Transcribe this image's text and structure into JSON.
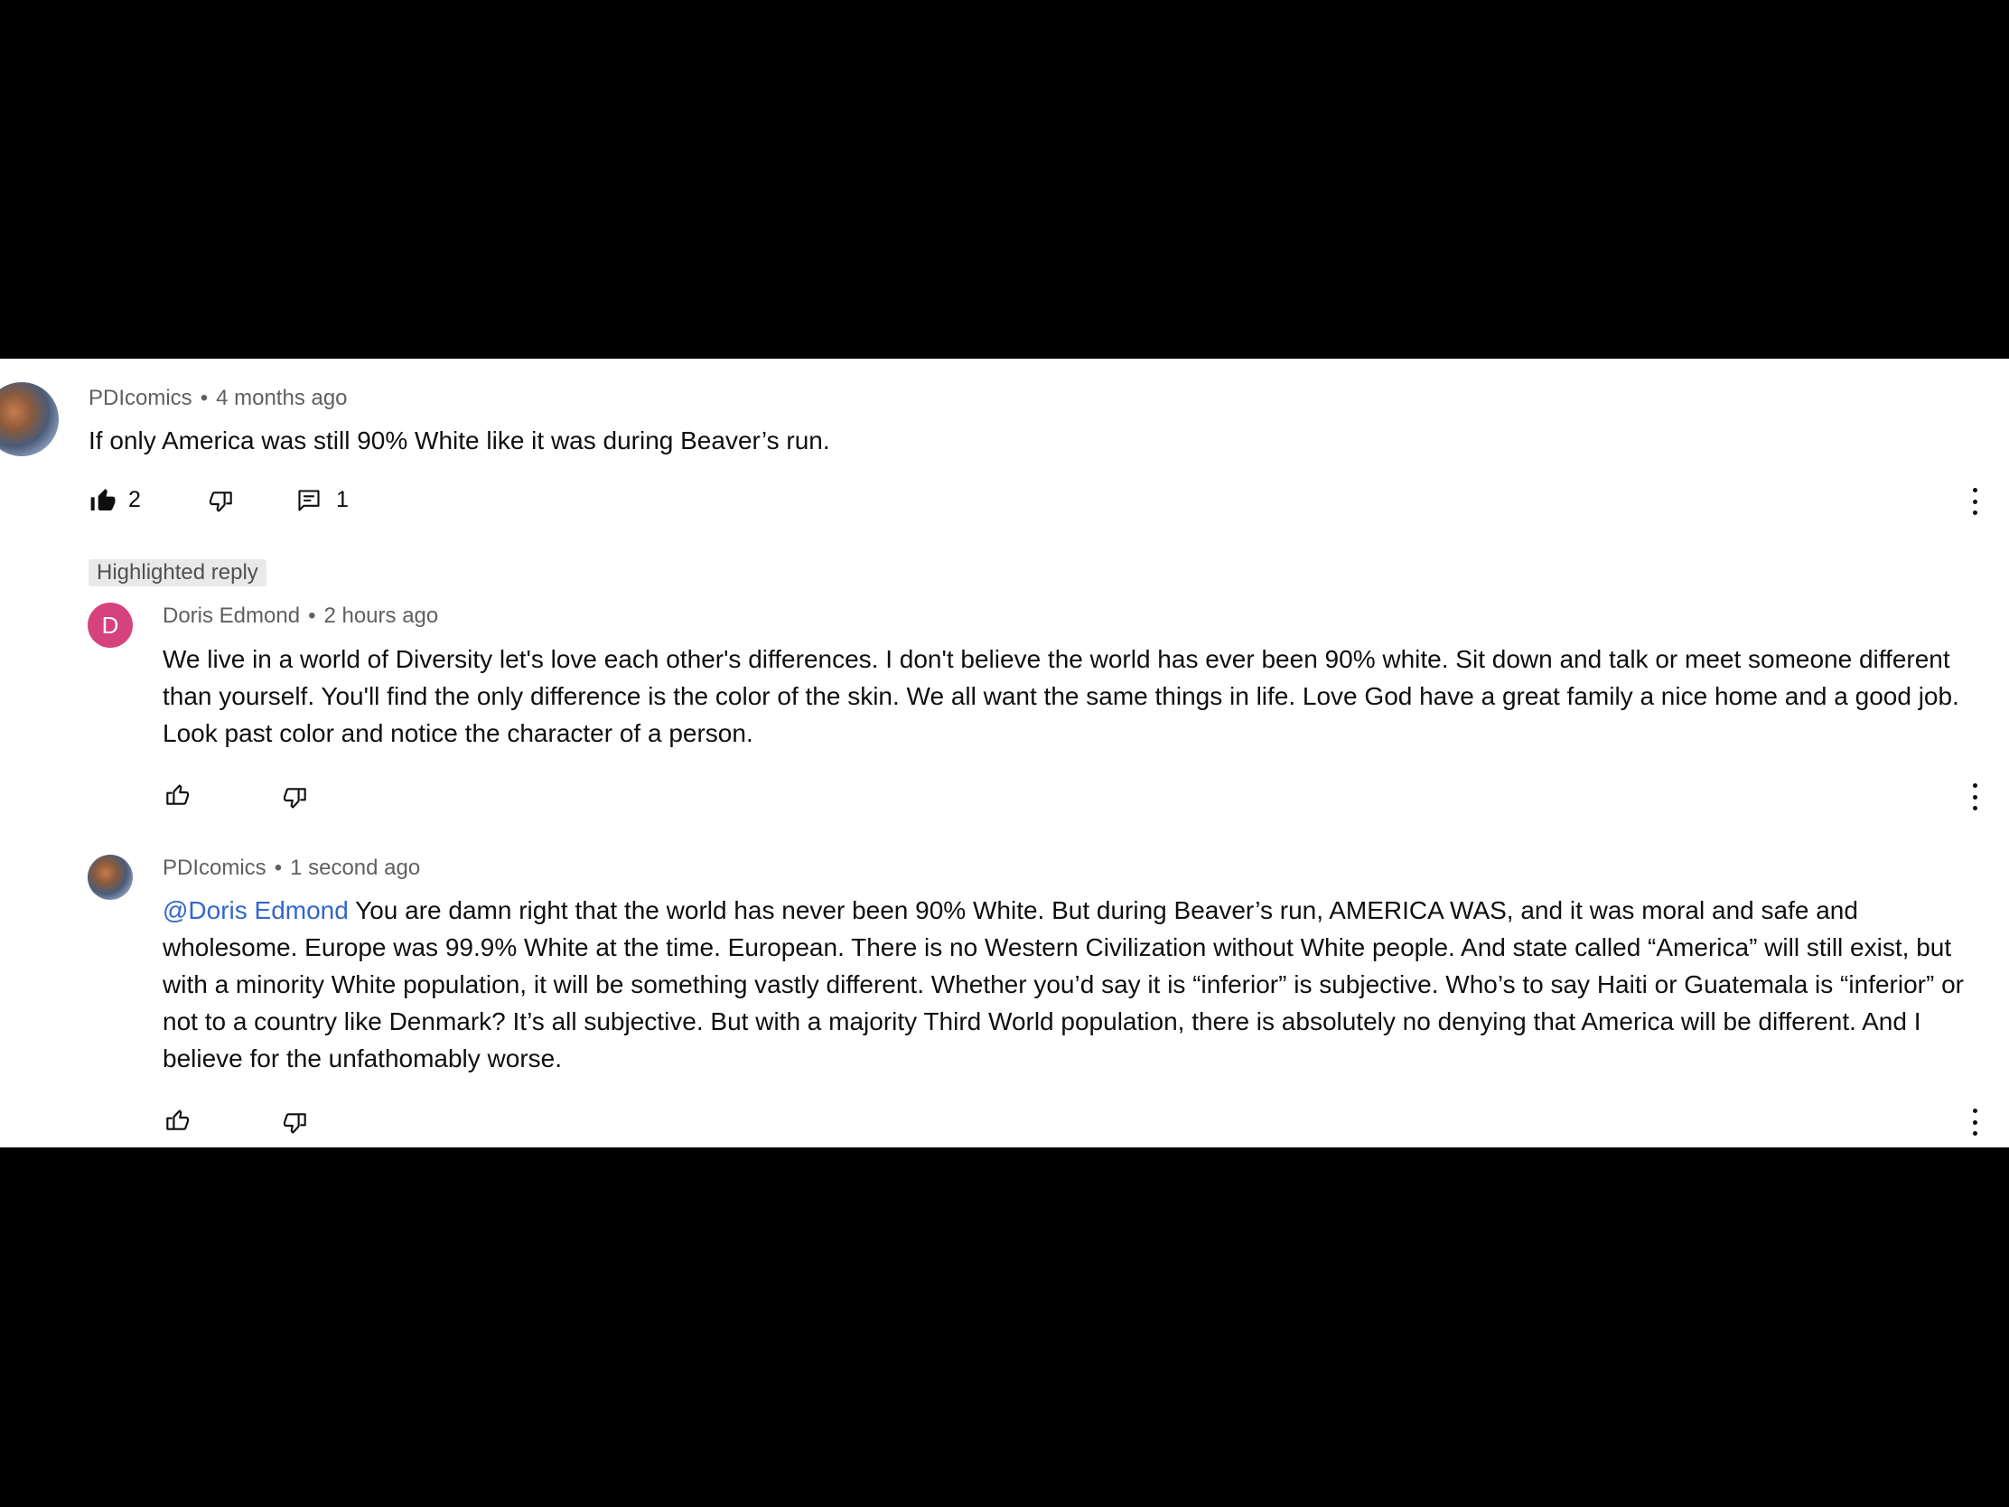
{
  "comments": [
    {
      "author": "PDIcomics",
      "time": "4 months ago",
      "text": "If only America was still 90% White like it was during Beaver’s run.",
      "likes": "2",
      "replies": "1"
    }
  ],
  "highlight_label": "Highlighted reply",
  "replies": [
    {
      "author": "Doris Edmond",
      "avatar_letter": "D",
      "avatar_color": "#d6427c",
      "time": "2 hours ago",
      "text": "We live in a world of Diversity let's love each other's differences. I don't believe the world has ever been 90% white. Sit down and talk or meet someone different than yourself. You'll find the only difference is the color of the skin. We all want the same things in life. Love God have a great family a nice home and a good job. Look past color and notice the character of a person."
    },
    {
      "author": "PDIcomics",
      "time": "1 second ago",
      "mention": "@Doris Edmond",
      "text": " You are damn right that the world has never been 90% White. But during Beaver’s run, AMERICA WAS, and it was moral and safe and wholesome. Europe was 99.9% White at the time. European. There is no Western Civilization without White people. And state called “America” will still exist, but with a minority White population, it will be something vastly different. Whether you’d say it is “inferior” is subjective. Who’s to say Haiti or Guatemala is “inferior” or not to a country like Denmark? It’s all subjective. But with a majority Third World population, there is absolutely no denying that America will be different. And I believe for the unfathomably worse."
    }
  ],
  "colors": {
    "mention": "#3366cc",
    "meta": "#606060",
    "text": "#0f0f0f"
  },
  "icons": [
    "thumbs-up-filled-icon",
    "thumbs-down-icon",
    "comment-icon",
    "more-vert-icon",
    "thumbs-up-icon"
  ]
}
